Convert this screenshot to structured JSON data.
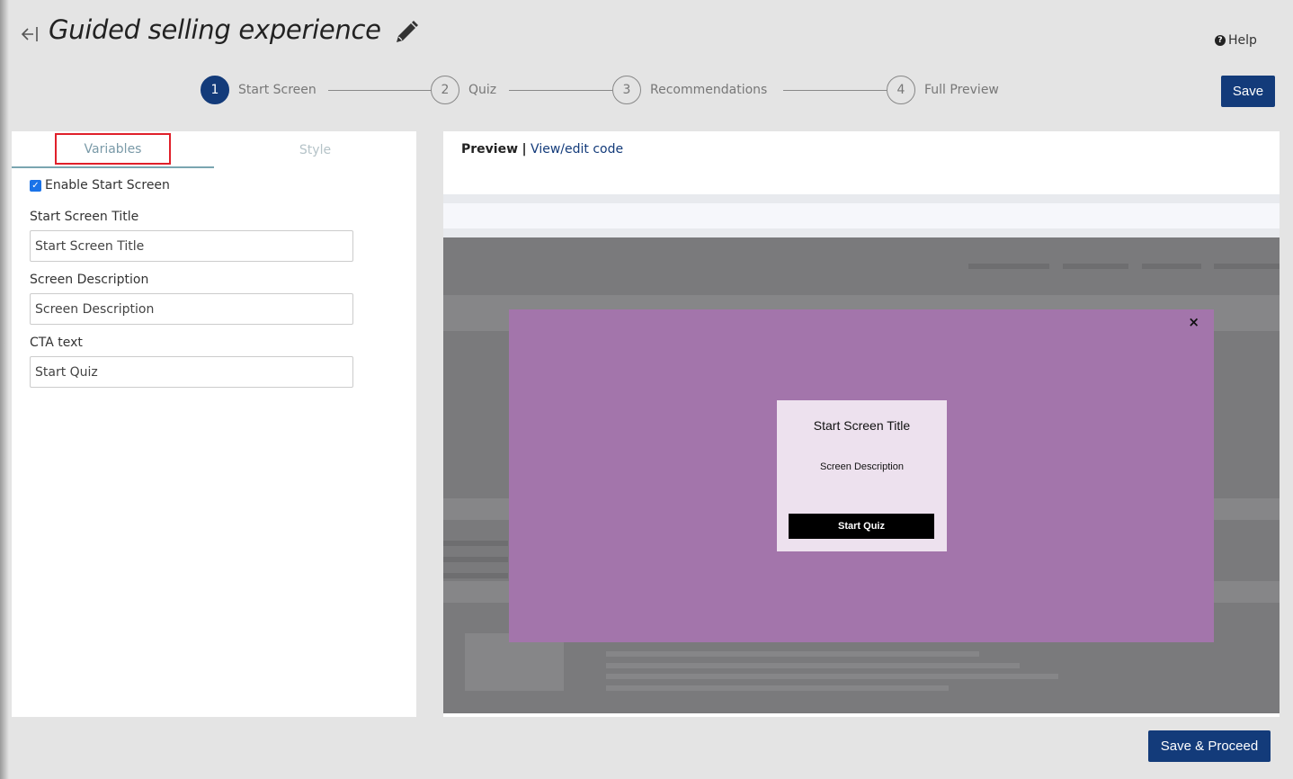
{
  "header": {
    "title": "Guided selling experience",
    "help_label": "Help",
    "save_label": "Save"
  },
  "stepper": {
    "steps": [
      {
        "number": "1",
        "label": "Start Screen",
        "active": true
      },
      {
        "number": "2",
        "label": "Quiz",
        "active": false
      },
      {
        "number": "3",
        "label": "Recommendations",
        "active": false
      },
      {
        "number": "4",
        "label": "Full Preview",
        "active": false
      }
    ]
  },
  "left_panel": {
    "tabs": [
      {
        "label": "Variables",
        "selected": true
      },
      {
        "label": "Style",
        "selected": false
      }
    ],
    "enable_start_screen": {
      "label": "Enable Start Screen",
      "checked": true
    },
    "fields": [
      {
        "label": "Start Screen Title",
        "value": "Start Screen Title"
      },
      {
        "label": "Screen Description",
        "value": "Screen Description"
      },
      {
        "label": "CTA text",
        "value": "Start Quiz"
      }
    ]
  },
  "preview": {
    "title": "Preview",
    "separator": "|",
    "code_link": "View/edit code",
    "modal": {
      "close_glyph": "×",
      "title": "Start Screen Title",
      "description": "Screen Description",
      "cta": "Start Quiz",
      "background_color": "#a375ab",
      "card_color": "#ede1ee"
    }
  },
  "footer": {
    "save_proceed_label": "Save & Proceed"
  },
  "colors": {
    "primary": "#133b7a",
    "highlight_box": "#e0202a",
    "modal_overlay": "#7a7a7c"
  }
}
